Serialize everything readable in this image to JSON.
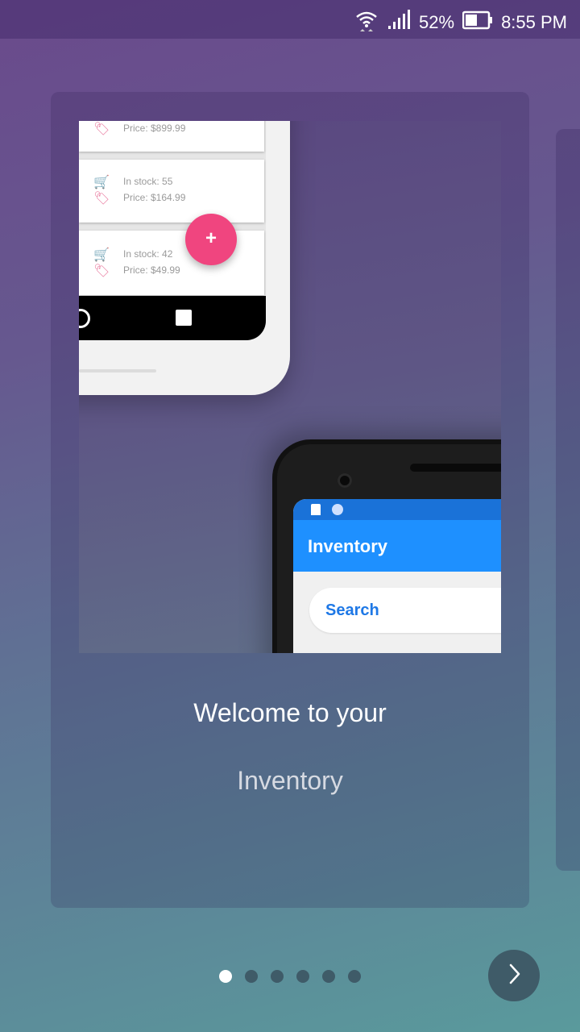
{
  "status_bar": {
    "battery_percent": "52%",
    "time": "8:55 PM",
    "icons": [
      "wifi-icon",
      "signal-icon",
      "battery-icon"
    ]
  },
  "hero": {
    "light_phone_items": [
      {
        "price": "Price: $899.99"
      },
      {
        "stock": "In stock: 55",
        "price": "Price: $164.99"
      },
      {
        "stock": "In stock: 42",
        "price": "Price: $49.99"
      }
    ],
    "fab_label": "+",
    "dark_phone": {
      "app_title": "Inventory",
      "search_text": "Search"
    }
  },
  "onboarding": {
    "title": "Welcome to your",
    "subtitle": "Inventory",
    "page_count": 6,
    "active_page": 1
  },
  "colors": {
    "accent_pink": "#f0457f",
    "app_blue": "#1e90ff",
    "dot_inactive": "#3f5b68"
  }
}
